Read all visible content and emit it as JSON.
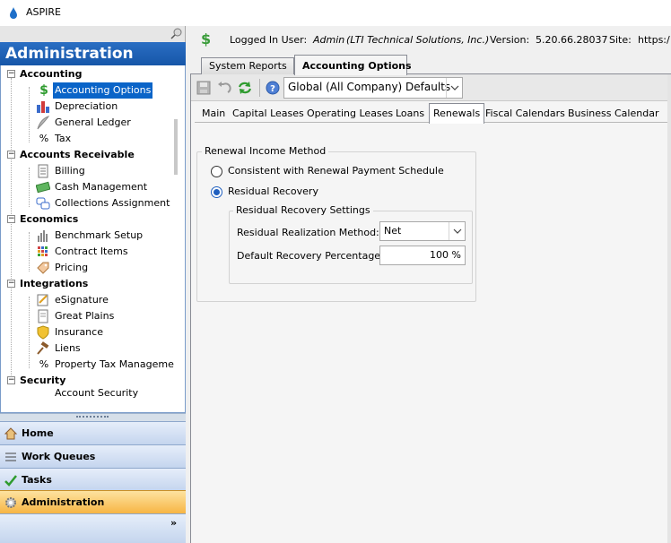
{
  "app": {
    "title": "ASPIRE"
  },
  "sidebar": {
    "header": "Administration",
    "groups": [
      {
        "label": "Accounting",
        "items": [
          "Accounting Options",
          "Depreciation",
          "General Ledger",
          "Tax"
        ]
      },
      {
        "label": "Accounts Receivable",
        "items": [
          "Billing",
          "Cash Management",
          "Collections Assignment"
        ]
      },
      {
        "label": "Economics",
        "items": [
          "Benchmark Setup",
          "Contract Items",
          "Pricing"
        ]
      },
      {
        "label": "Integrations",
        "items": [
          "eSignature",
          "Great Plains",
          "Insurance",
          "Liens",
          "Property Tax Manageme"
        ]
      },
      {
        "label": "Security",
        "items": [
          "Account Security"
        ]
      }
    ],
    "tax_glyph": "%",
    "property_glyph": "%",
    "selected_item": "Accounting Options"
  },
  "nav": {
    "buttons": [
      "Home",
      "Work Queues",
      "Tasks",
      "Administration"
    ],
    "active": "Administration",
    "more_glyph": "»"
  },
  "userbar": {
    "logged_in_label": "Logged In User:",
    "user": "Admin",
    "company": "(LTI Technical Solutions, Inc.)",
    "version_label": "Version:",
    "version": "5.20.66.28037",
    "site_label": "Site:",
    "site": "https:/"
  },
  "doc_tabs": [
    "System Reports",
    "Accounting Options"
  ],
  "active_doc_tab": "Accounting Options",
  "toolbar": {
    "scope_value": "Global (All Company) Defaults"
  },
  "sub_tabs": [
    "Main",
    "Capital Leases",
    "Operating Leases",
    "Loans",
    "Renewals",
    "Fiscal Calendars",
    "Business Calendar"
  ],
  "active_sub_tab": "Renewals",
  "renewals": {
    "group_title": "Renewal Income Method",
    "option_1": "Consistent with Renewal Payment Schedule",
    "option_2": "Residual Recovery",
    "selected_option": 2,
    "settings_title": "Residual Recovery Settings",
    "method_label": "Residual Realization Method:",
    "method_value": "Net",
    "pct_label": "Default Recovery Percentage:",
    "pct_value": "100 %"
  },
  "colors": {
    "header_blue": "#1656a8",
    "selected_blue": "#0a64c8",
    "active_nav": "#f7b544"
  }
}
